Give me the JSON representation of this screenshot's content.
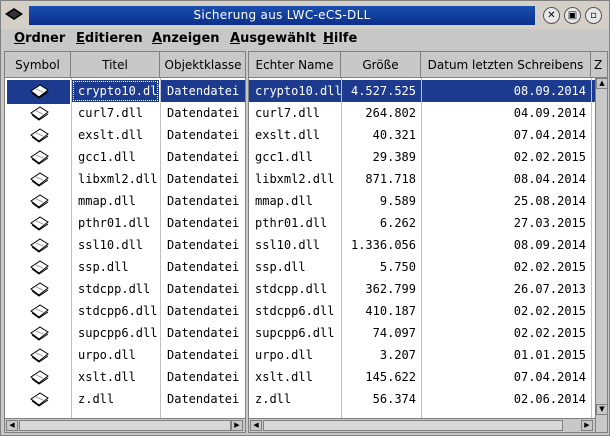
{
  "window": {
    "title": "Sicherung aus LWC-eCS-DLL"
  },
  "menu": [
    {
      "label": "Ordner",
      "u": "O",
      "rest": "rdner"
    },
    {
      "label": "Editieren",
      "u": "E",
      "rest": "ditieren"
    },
    {
      "label": "Anzeigen",
      "u": "A",
      "rest": "nzeigen"
    },
    {
      "label": "Ausgewählt",
      "u": "A",
      "rest": "usgewählt"
    },
    {
      "label": "Hilfe",
      "u": "H",
      "rest": "ilfe"
    }
  ],
  "left_headers": [
    "Symbol",
    "Titel",
    "Objektklasse"
  ],
  "right_headers": [
    "Echter Name",
    "Größe",
    "Datum letzten Schreibens",
    "Z"
  ],
  "files": [
    {
      "title": "crypto10.dll",
      "class": "Datendatei",
      "name": "crypto10.dll",
      "size": "4.527.525",
      "date": "08.09.2014",
      "selected": true
    },
    {
      "title": "curl7.dll",
      "class": "Datendatei",
      "name": "curl7.dll",
      "size": "264.802",
      "date": "04.09.2014"
    },
    {
      "title": "exslt.dll",
      "class": "Datendatei",
      "name": "exslt.dll",
      "size": "40.321",
      "date": "07.04.2014"
    },
    {
      "title": "gcc1.dll",
      "class": "Datendatei",
      "name": "gcc1.dll",
      "size": "29.389",
      "date": "02.02.2015"
    },
    {
      "title": "libxml2.dll",
      "class": "Datendatei",
      "name": "libxml2.dll",
      "size": "871.718",
      "date": "08.04.2014"
    },
    {
      "title": "mmap.dll",
      "class": "Datendatei",
      "name": "mmap.dll",
      "size": "9.589",
      "date": "25.08.2014"
    },
    {
      "title": "pthr01.dll",
      "class": "Datendatei",
      "name": "pthr01.dll",
      "size": "6.262",
      "date": "27.03.2015"
    },
    {
      "title": "ssl10.dll",
      "class": "Datendatei",
      "name": "ssl10.dll",
      "size": "1.336.056",
      "date": "08.09.2014"
    },
    {
      "title": "ssp.dll",
      "class": "Datendatei",
      "name": "ssp.dll",
      "size": "5.750",
      "date": "02.02.2015"
    },
    {
      "title": "stdcpp.dll",
      "class": "Datendatei",
      "name": "stdcpp.dll",
      "size": "362.799",
      "date": "26.07.2013"
    },
    {
      "title": "stdcpp6.dll",
      "class": "Datendatei",
      "name": "stdcpp6.dll",
      "size": "410.187",
      "date": "02.02.2015"
    },
    {
      "title": "supcpp6.dll",
      "class": "Datendatei",
      "name": "supcpp6.dll",
      "size": "74.097",
      "date": "02.02.2015"
    },
    {
      "title": "urpo.dll",
      "class": "Datendatei",
      "name": "urpo.dll",
      "size": "3.207",
      "date": "01.01.2015"
    },
    {
      "title": "xslt.dll",
      "class": "Datendatei",
      "name": "xslt.dll",
      "size": "145.622",
      "date": "07.04.2014"
    },
    {
      "title": "z.dll",
      "class": "Datendatei",
      "name": "z.dll",
      "size": "56.374",
      "date": "02.06.2014"
    }
  ],
  "colors": {
    "selection": "#1c3b8f",
    "titlebar": "#0b2f8a"
  }
}
